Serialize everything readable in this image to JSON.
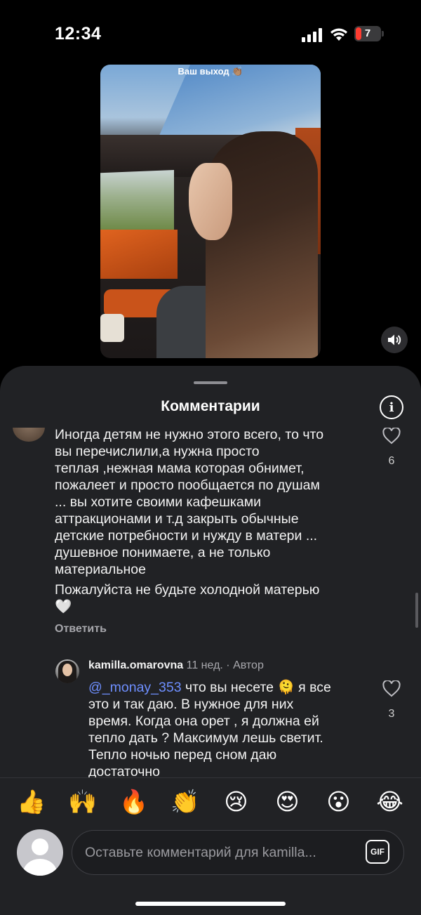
{
  "status_bar": {
    "time": "12:34",
    "battery_level": "7",
    "icons": [
      "cellular-signal-icon",
      "wifi-icon",
      "battery-icon"
    ]
  },
  "video": {
    "caption": "Ваш выход 👏🏽",
    "sound_icon": "speaker-icon"
  },
  "sheet": {
    "title": "Комментарии",
    "info_icon": "i"
  },
  "comments": [
    {
      "text_lines": [
        "Иногда детям не нужно этого всего, то что",
        "вы перечислили,а нужна просто",
        "теплая ,нежная мама которая обнимет,",
        "пожалеет и просто пообщается по душам",
        "... вы хотите своими кафешками",
        "аттракционами и т.д закрыть обычные",
        "детские потребности и нужду в матери ...",
        "душевное понимаете, а не только",
        "материальное"
      ],
      "text_lines_2": [
        "Пожалуйста не будьте холодной матерью",
        "🤍"
      ],
      "likes": "6",
      "reply_label": "Ответить"
    },
    {
      "username": "kamilla.omarovna",
      "time": "11 нед.",
      "separator": "·",
      "badge": "Автор",
      "mention": "@_monay_353",
      "text_first_line_rest": " что вы несете 🫠 я все",
      "text_lines": [
        "это и так даю.  В нужное для них",
        "время.  Когда она орет , я должна ей",
        "тепло дать ? Максимум лешь светит.",
        "Тепло ночью перед сном даю",
        "достаточно"
      ],
      "likes": "3"
    }
  ],
  "reactions": [
    "👍",
    "🙌",
    "🔥",
    "👏",
    "😢",
    "😍",
    "😮",
    "😂"
  ],
  "composer": {
    "placeholder": "Оставьте комментарий для kamilla...",
    "gif_label": "GIF"
  },
  "colors": {
    "background": "#000000",
    "sheet": "#212225",
    "mention": "#6e8fff",
    "secondary_text": "#a8a8ad"
  }
}
